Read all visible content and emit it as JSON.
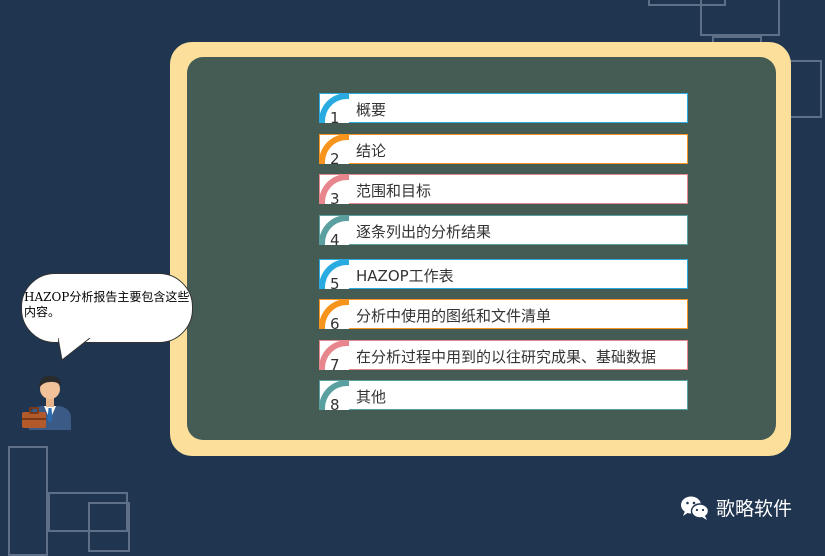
{
  "speech_bubble": {
    "text": "HAZOP分析报告主要包含这些内容。"
  },
  "items": [
    {
      "num": "1",
      "label": "概要",
      "color": "#29abe2"
    },
    {
      "num": "2",
      "label": "结论",
      "color": "#f7941d"
    },
    {
      "num": "3",
      "label": "范围和目标",
      "color": "#e8868d"
    },
    {
      "num": "4",
      "label": "逐条列出的分析结果",
      "color": "#5aa0a0"
    },
    {
      "num": "5",
      "label": "HAZOP工作表",
      "color": "#29abe2"
    },
    {
      "num": "6",
      "label": "分析中使用的图纸和文件清单",
      "color": "#f7941d"
    },
    {
      "num": "7",
      "label": "在分析过程中用到的以往研究成果、基础数据",
      "color": "#e8868d"
    },
    {
      "num": "8",
      "label": "其他",
      "color": "#5aa0a0"
    }
  ],
  "brand": {
    "name": "歌略软件",
    "icon": "wechat-icon"
  },
  "colors": {
    "background": "#1f3550",
    "board": "#445c54",
    "board_frame": "#fbdf9a"
  }
}
